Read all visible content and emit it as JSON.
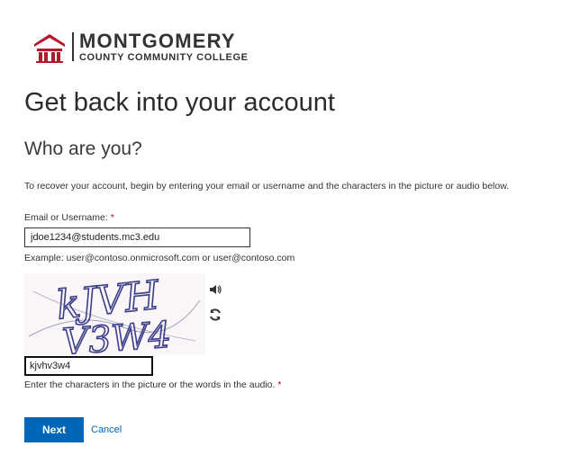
{
  "logo": {
    "name_line1": "MONTGOMERY",
    "name_line2": "COUNTY COMMUNITY COLLEGE",
    "icon": "college-building-icon"
  },
  "page": {
    "title": "Get back into your account",
    "subtitle": "Who are you?",
    "instructions": "To recover your account, begin by entering your email or username and the characters in the picture or audio below."
  },
  "email_field": {
    "label": "Email or Username:",
    "required_marker": "*",
    "value": "jdoe1234@students.mc3.edu",
    "example": "Example: user@contoso.onmicrosoft.com or user@contoso.com"
  },
  "captcha": {
    "image_text": "kJVH V3W4",
    "audio_icon": "speaker-icon",
    "refresh_icon": "refresh-icon",
    "input_value": "kjvhv3w4",
    "help_text": "Enter the characters in the picture or the words in the audio.",
    "required_marker": "*"
  },
  "actions": {
    "next_label": "Next",
    "cancel_label": "Cancel"
  },
  "colors": {
    "accent": "#0067b8",
    "required": "#c00000",
    "logo_red": "#b1182b"
  }
}
